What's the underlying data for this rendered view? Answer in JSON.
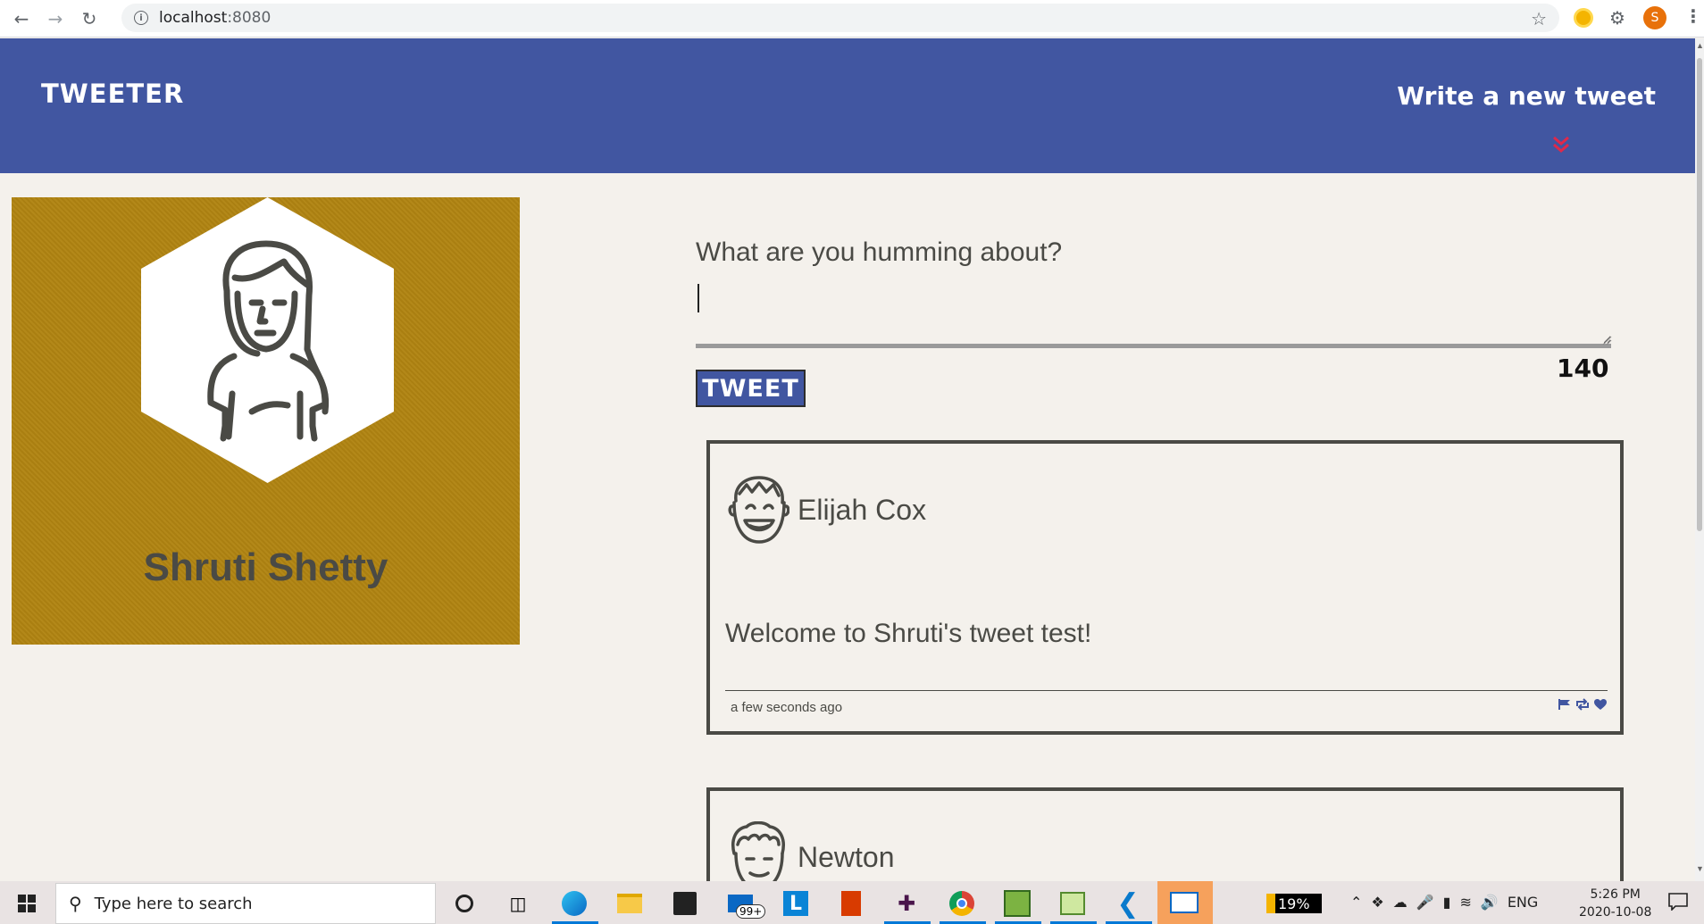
{
  "browser": {
    "url_host": "localhost",
    "url_port": ":8080",
    "profile_initial": "S"
  },
  "header": {
    "brand": "TWEETER",
    "write_new": "Write a new tweet"
  },
  "profile": {
    "name": "Shruti Shetty"
  },
  "composer": {
    "label": "What are you humming about?",
    "value": "",
    "button_label": "TWEET",
    "counter": "140"
  },
  "tweets": [
    {
      "author": "Elijah Cox",
      "text": "Welcome to Shruti's tweet test!",
      "time": "a few seconds ago"
    },
    {
      "author": "Newton"
    }
  ],
  "taskbar": {
    "search_placeholder": "Type here to search",
    "mail_badge": "99+",
    "battery": "19%",
    "lang": "ENG",
    "time": "5:26 PM",
    "date": "2020-10-08"
  },
  "colors": {
    "header_bg": "#4156a1",
    "profile_bg": "#b18412",
    "page_bg": "#f4f1ec",
    "accent_red": "#e0284a"
  }
}
